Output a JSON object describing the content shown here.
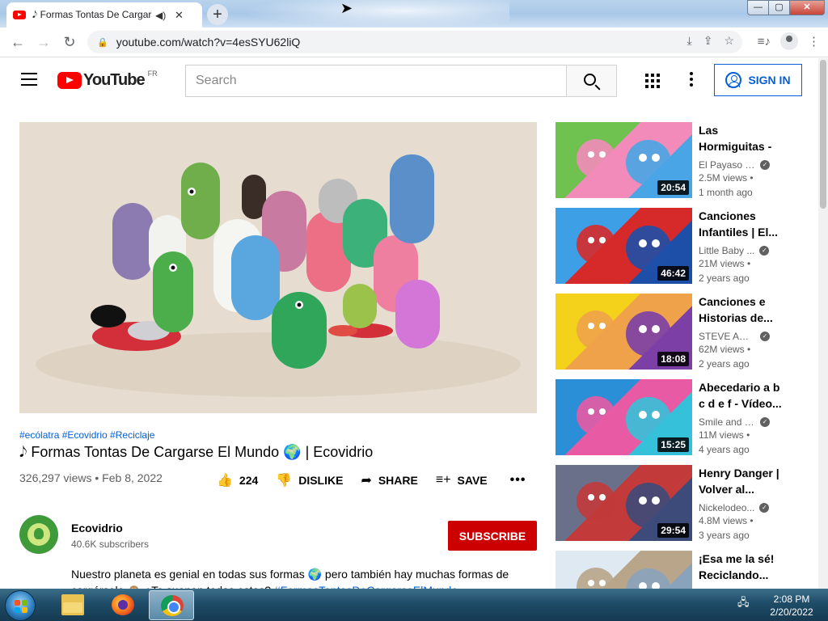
{
  "browser": {
    "tab_title": "𝅘𝅥𝅮 Formas Tontas De Cargarse El Mundo 🌍 | Ecovidrio - YouTube",
    "new_tab": "+",
    "url": "youtube.com/watch?v=4esSYU62liQ",
    "win_min": "—",
    "win_max": "▢",
    "win_close": "✕"
  },
  "header": {
    "logo_text": "YouTube",
    "country": "FR",
    "search_placeholder": "Search",
    "sign_in": "SIGN IN"
  },
  "video": {
    "hashtags": "#ecólatra #Ecovidrio #Reciclaje",
    "title": "𝅘𝅥𝅮 Formas Tontas De Cargarse El Mundo 🌍 | Ecovidrio",
    "meta": "326,297 views • Feb 8, 2022",
    "likes": "224",
    "dislike": "DISLIKE",
    "share": "SHARE",
    "save": "SAVE",
    "more": "•••"
  },
  "channel": {
    "name": "Ecovidrio",
    "subscribers": "40.6K subscribers",
    "subscribe": "SUBSCRIBE"
  },
  "description": {
    "line1": "Nuestro planeta es genial en todas sus formas 🌍 pero también hay muchas formas de",
    "line2_prefix": "cargárselo 🙈 ¿Te suenan todas estas? ",
    "line2_tag": "#FormasTontasDeCargarseElMundo"
  },
  "sidebar": {
    "items": [
      {
        "title": "Las Hormiguitas - ...",
        "channel": "El Payaso Pl...",
        "views": "2.5M views •",
        "age": "1 month ago",
        "duration": "20:54",
        "colors": [
          "#6fc24f",
          "#f28bb9",
          "#49a5e6"
        ]
      },
      {
        "title": "Canciones Infantiles | El...",
        "channel": "Little Baby ...",
        "views": "21M views •",
        "age": "2 years ago",
        "duration": "46:42",
        "colors": [
          "#3da0e6",
          "#d62a2a",
          "#1e4fa8"
        ]
      },
      {
        "title": "Canciones e Historias de...",
        "channel": "STEVE AND MA...",
        "views": "62M views •",
        "age": "2 years ago",
        "duration": "18:08",
        "colors": [
          "#f4d21c",
          "#f0a24a",
          "#7b3fa6"
        ]
      },
      {
        "title": "Abecedario a b c d e f - Vídeo...",
        "channel": "Smile and L...",
        "views": "11M views •",
        "age": "4 years ago",
        "duration": "15:25",
        "colors": [
          "#2a8fd6",
          "#e85aa3",
          "#35c1d9"
        ]
      },
      {
        "title": "Henry Danger | Volver al...",
        "channel": "Nickelodeo...",
        "views": "4.8M views •",
        "age": "3 years ago",
        "duration": "29:54",
        "colors": [
          "#6a6f8a",
          "#c23a3a",
          "#3c4b7a"
        ]
      },
      {
        "title": "¡Esa me la sé! Reciclando...",
        "channel": "",
        "views": "",
        "age": "",
        "duration": "",
        "colors": [
          "#dfe9f2",
          "#b9a58a",
          "#8aa3bd"
        ]
      }
    ]
  },
  "taskbar": {
    "time": "2:08 PM",
    "date": "2/20/2022"
  },
  "colors": {
    "youtube_red": "#ff0000",
    "subscribe_red": "#cc0000",
    "link_blue": "#065fd4"
  },
  "icons": [
    "youtube-favicon",
    "audio-icon",
    "close-icon",
    "back-icon",
    "forward-icon",
    "reload-icon",
    "lock-icon",
    "install-icon",
    "share-icon",
    "star-icon",
    "media-icon",
    "profile-icon",
    "menu-icon",
    "search-icon",
    "apps-icon",
    "more-icon",
    "account-icon",
    "like-icon",
    "dislike-icon",
    "share-arrow-icon",
    "playlist-add-icon",
    "verified-icon",
    "windows-start-icon",
    "explorer-icon",
    "firefox-icon",
    "chrome-icon",
    "network-icon"
  ]
}
